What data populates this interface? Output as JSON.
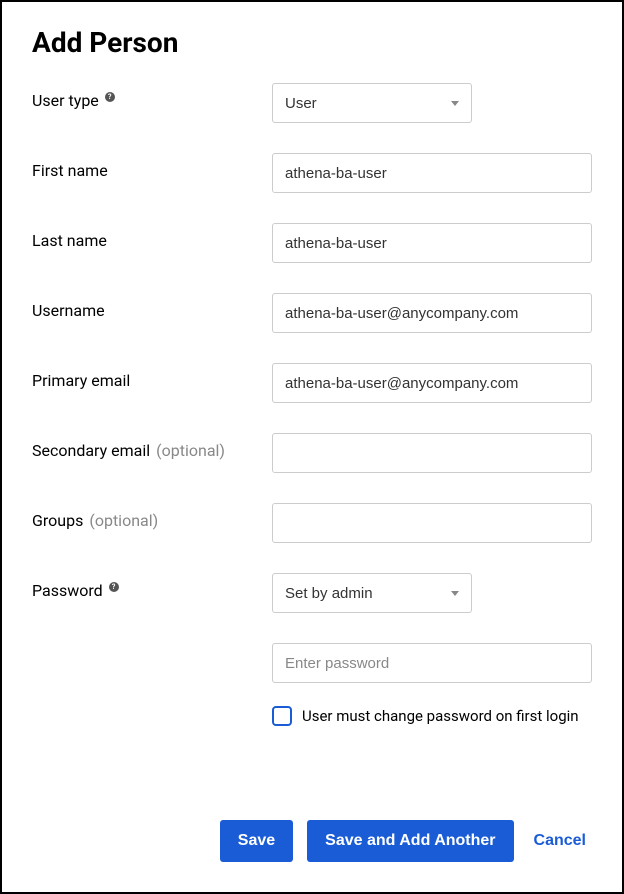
{
  "title": "Add Person",
  "form": {
    "user_type": {
      "label": "User type",
      "value": "User"
    },
    "first_name": {
      "label": "First name",
      "value": "athena-ba-user"
    },
    "last_name": {
      "label": "Last name",
      "value": "athena-ba-user"
    },
    "username": {
      "label": "Username",
      "value": "athena-ba-user@anycompany.com"
    },
    "primary_email": {
      "label": "Primary email",
      "value": "athena-ba-user@anycompany.com"
    },
    "secondary_email": {
      "label": "Secondary email ",
      "optional": "(optional)",
      "value": ""
    },
    "groups": {
      "label": "Groups ",
      "optional": "(optional)",
      "value": ""
    },
    "password": {
      "label": "Password",
      "mode": "Set by admin",
      "placeholder": "Enter password",
      "checkbox_label": "User must change password on first login"
    }
  },
  "buttons": {
    "save": "Save",
    "save_add": "Save and Add Another",
    "cancel": "Cancel"
  }
}
